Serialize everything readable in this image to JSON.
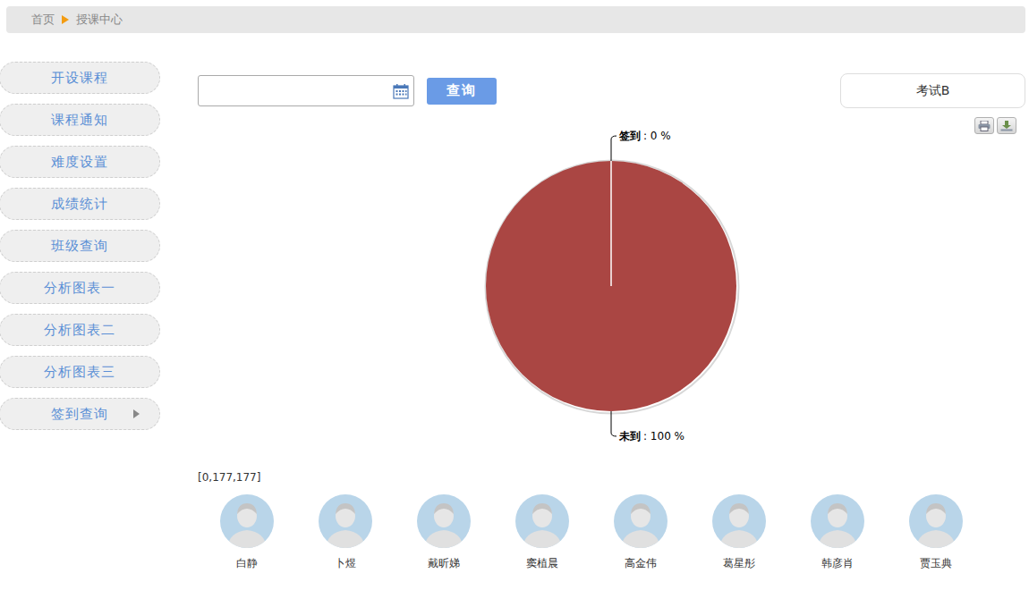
{
  "breadcrumb": [
    {
      "label": "首页"
    },
    {
      "label": "授课中心"
    }
  ],
  "sidebar": {
    "items": [
      {
        "label": "开设课程",
        "kind": "link"
      },
      {
        "label": "课程通知",
        "kind": "link"
      },
      {
        "label": "难度设置",
        "kind": "link"
      },
      {
        "label": "成绩统计",
        "kind": "link"
      },
      {
        "label": "班级查询",
        "kind": "link"
      },
      {
        "label": "分析图表一",
        "kind": "link"
      },
      {
        "label": "分析图表二",
        "kind": "link"
      },
      {
        "label": "分析图表三",
        "kind": "link"
      },
      {
        "label": "签到查询",
        "kind": "submenu"
      }
    ]
  },
  "date_input": {
    "value": ""
  },
  "query_button": "查询",
  "exam_select": {
    "value": "考试B"
  },
  "chart": {
    "slices": [
      {
        "label": "签到",
        "value": 0,
        "reading": ": 0 %",
        "color": "#4572a7"
      },
      {
        "label": "未到",
        "value": 100,
        "reading": ": 100 %",
        "color": "#aa4643"
      }
    ]
  },
  "counts": "[0,177,177]",
  "students": [
    {
      "name": "白静"
    },
    {
      "name": "卜煜"
    },
    {
      "name": "戴昕娣"
    },
    {
      "name": "窦植晨"
    },
    {
      "name": "高金伟"
    },
    {
      "name": "葛星彤"
    },
    {
      "name": "韩彦肖"
    },
    {
      "name": "贾玉典"
    }
  ]
}
